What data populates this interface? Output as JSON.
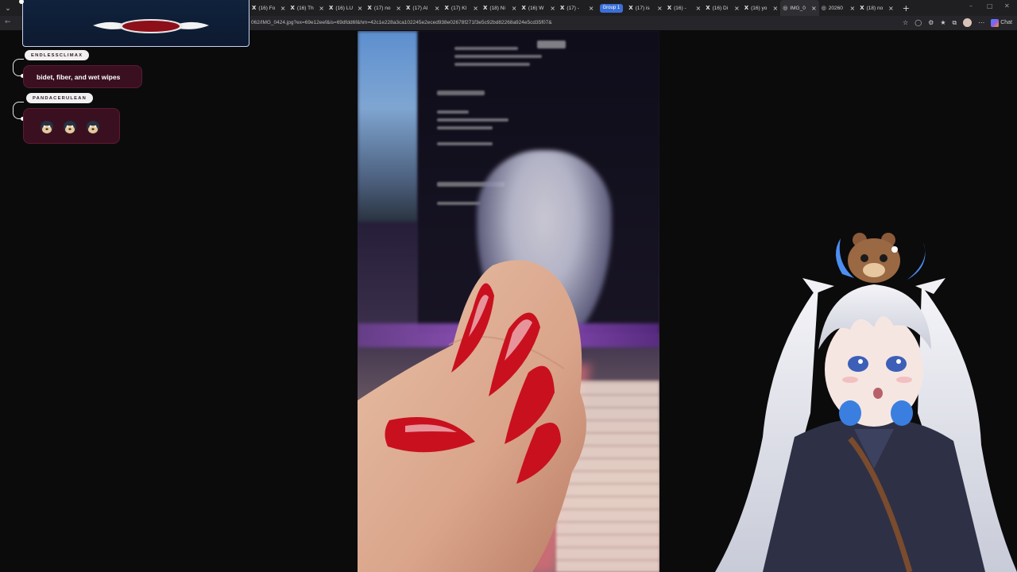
{
  "browser": {
    "tabs": [
      {
        "icon": "x",
        "label": "(16) Fo"
      },
      {
        "icon": "x",
        "label": "(16) Th"
      },
      {
        "icon": "x",
        "label": "(16) LU"
      },
      {
        "icon": "x",
        "label": "(17) no"
      },
      {
        "icon": "x",
        "label": "(17) Al"
      },
      {
        "icon": "x",
        "label": "(17) Kl"
      },
      {
        "icon": "x",
        "label": "(18) Ni"
      },
      {
        "icon": "x",
        "label": "(16) W"
      },
      {
        "icon": "x",
        "label": "(17) -"
      }
    ],
    "group_label": "Group 1",
    "tabs_after_group": [
      {
        "icon": "x",
        "label": "(17) is"
      },
      {
        "icon": "x",
        "label": "(16) -"
      },
      {
        "icon": "x",
        "label": "(16) Di"
      },
      {
        "icon": "x",
        "label": "(16) yo"
      },
      {
        "icon": "globe",
        "label": "IMG_0",
        "active": true
      },
      {
        "icon": "globe",
        "label": "20260"
      },
      {
        "icon": "x",
        "label": "(18) no"
      }
    ],
    "url": "062/IMG_0424.jpg?ex=69e12eef&is=69dfdd6f&hm=42c1e228a3ca102245e2eced938e02678f271f3e5c92bd82268a924e5cd35f07&",
    "chat_label": "Chat",
    "accent_color": "#3b6fd6"
  },
  "chat": [
    {
      "username": "ENDLESSCLIMAX",
      "message": "bidet, fiber, and wet wipes"
    },
    {
      "username": "PANDACERULEAN",
      "message": "",
      "emotes": [
        "dog-emote",
        "dog-emote",
        "dog-emote"
      ]
    }
  ],
  "colors": {
    "bubble": "#3a1020",
    "alert_border": "#c9d4f2",
    "nail": "#c9101f"
  }
}
